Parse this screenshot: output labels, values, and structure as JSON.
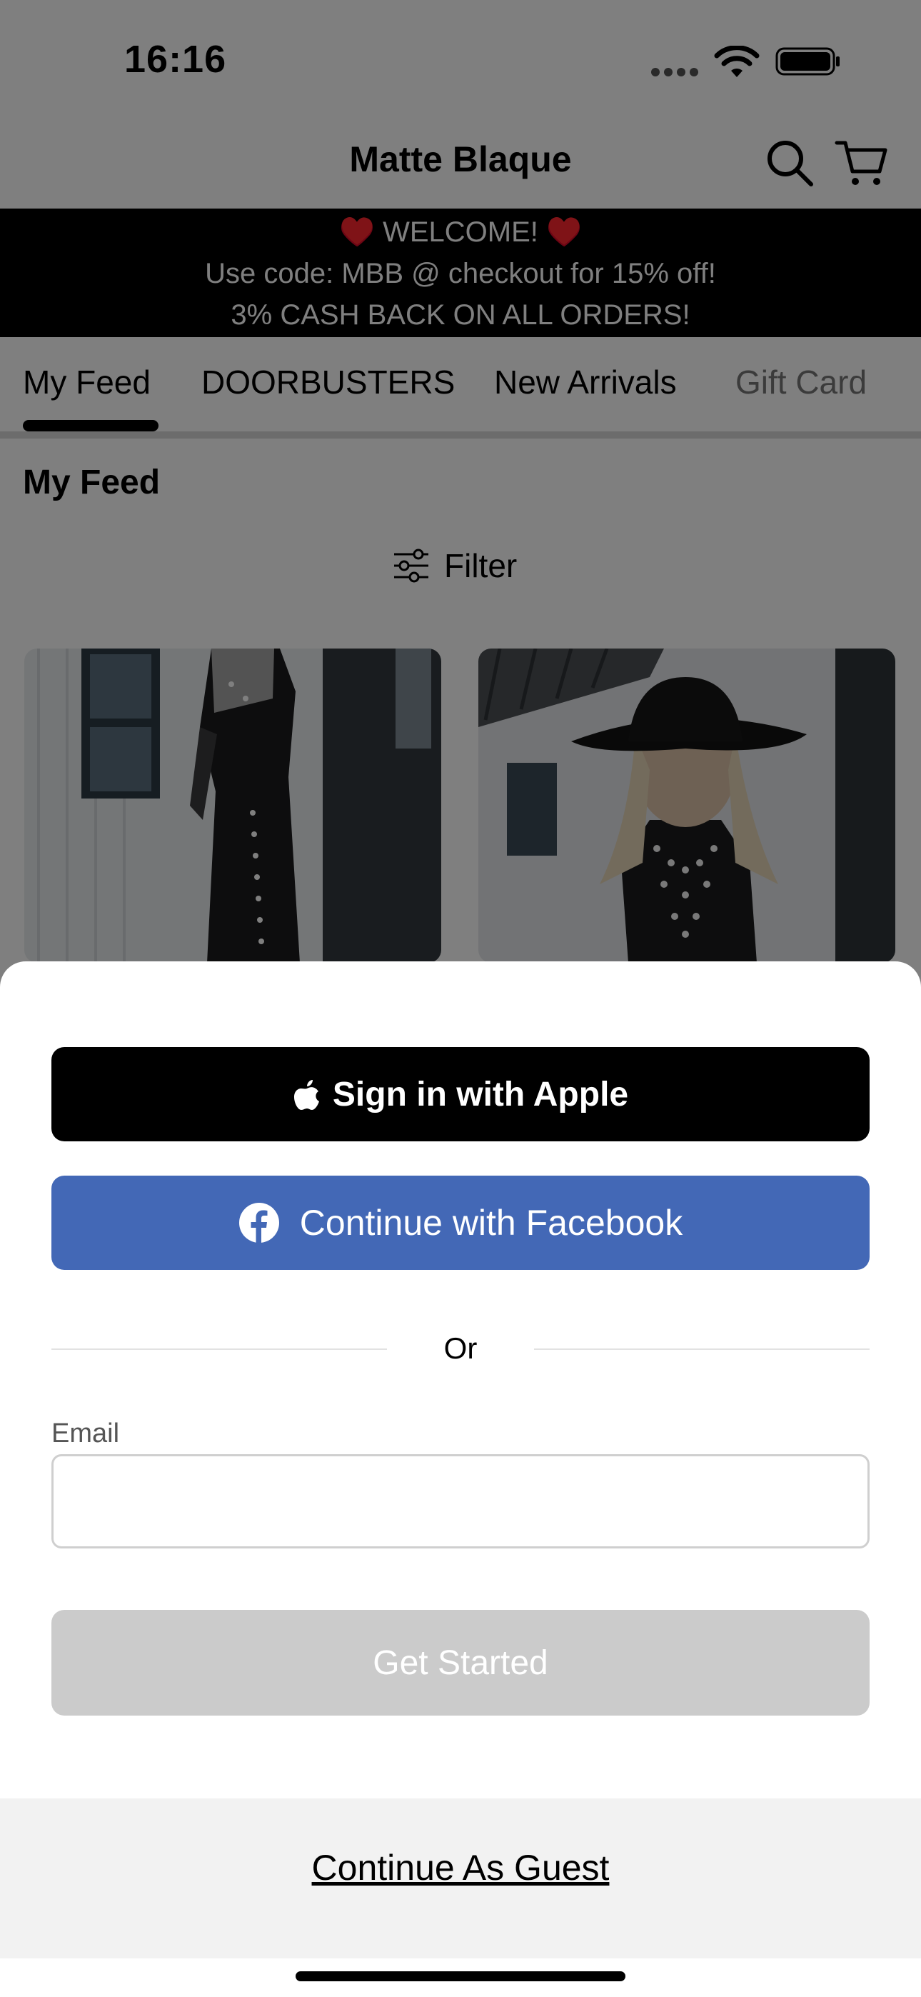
{
  "status_bar": {
    "time": "16:16"
  },
  "header": {
    "title": "Matte Blaque",
    "icons": [
      "search-icon",
      "cart-icon"
    ]
  },
  "promo": {
    "line1": "♥️ WELCOME! ♥️",
    "line2": "Use code: MBB @ checkout for 15% off!",
    "line3": "3% CASH BACK ON ALL ORDERS!"
  },
  "tabs": [
    {
      "label": "My Feed",
      "selected": true
    },
    {
      "label": "DOORBUSTERS",
      "selected": false
    },
    {
      "label": "New Arrivals",
      "selected": false
    },
    {
      "label": "Gift Card",
      "selected": false
    }
  ],
  "feed": {
    "title": "My Feed",
    "filter_label": "Filter"
  },
  "sheet": {
    "apple_label": "Sign in with Apple",
    "facebook_label": "Continue with Facebook",
    "or_label": "Or",
    "email_label": "Email",
    "email_value": "",
    "get_started_label": "Get Started",
    "guest_label": "Continue As Guest"
  },
  "colors": {
    "promo_bg": "#000000",
    "apple_bg": "#000000",
    "facebook_bg": "#4368b6",
    "get_started_bg": "#cbcbcb",
    "guest_area_bg": "#f2f2f2"
  }
}
